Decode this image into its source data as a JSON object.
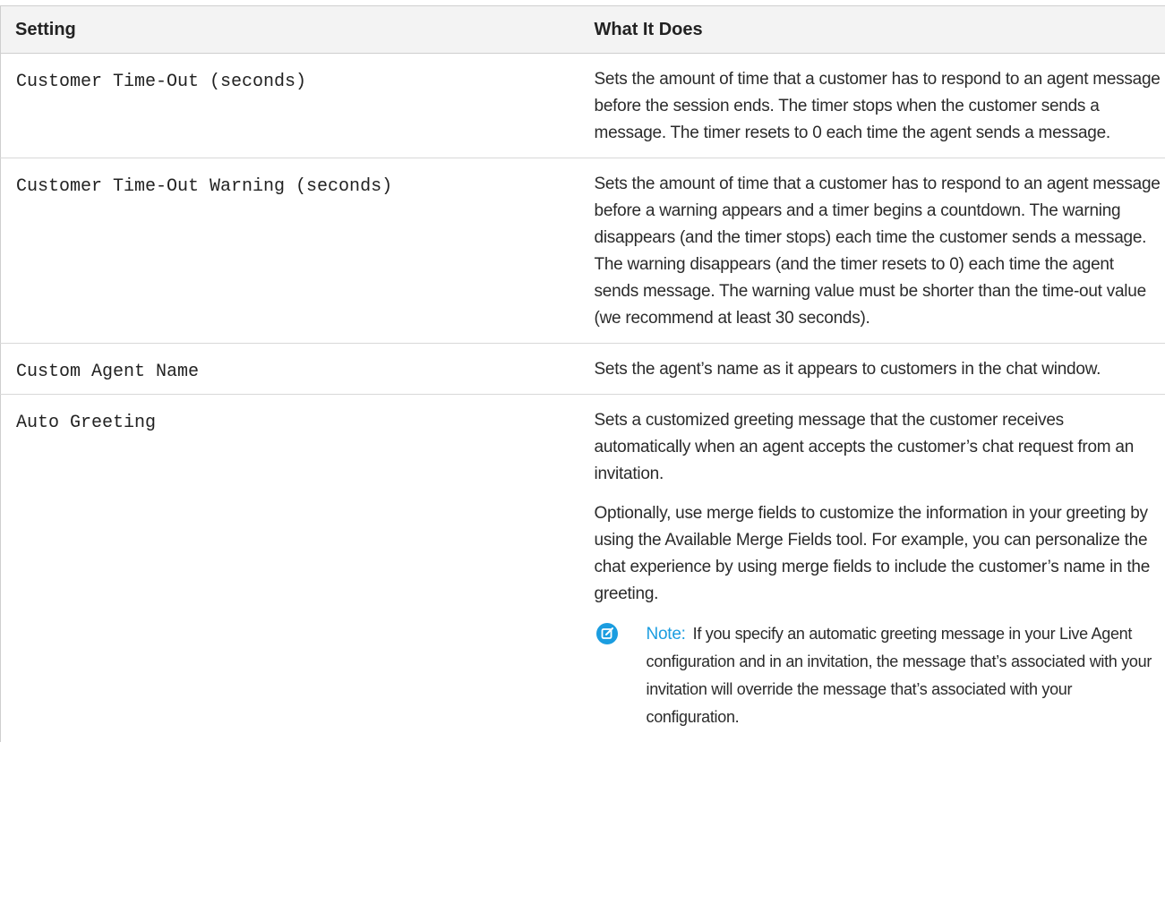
{
  "table": {
    "headers": [
      "Setting",
      "What It Does"
    ],
    "rows": [
      {
        "setting": "Customer Time-Out (seconds)",
        "paragraphs": [
          "Sets the amount of time that a customer has to respond to an agent message before the session ends. The timer stops when the customer sends a message. The timer resets to 0 each time the agent sends a message."
        ]
      },
      {
        "setting": "Customer Time-Out Warning (seconds)",
        "paragraphs": [
          "Sets the amount of time that a customer has to respond to an agent message before a warning appears and a timer begins a countdown. The warning disappears (and the timer stops) each time the customer sends a message. The warning disappears (and the timer resets to 0) each time the agent sends message. The warning value must be shorter than the time-out value (we recommend at least 30 seconds)."
        ]
      },
      {
        "setting": "Custom Agent Name",
        "paragraphs": [
          "Sets the agent’s name as it appears to customers in the chat window."
        ]
      },
      {
        "setting": "Auto Greeting",
        "paragraphs": [
          "Sets a customized greeting message that the customer receives automatically when an agent accepts the customer’s chat request from an invitation.",
          "Optionally, use merge fields to customize the information in your greeting by using the Available Merge Fields tool. For example, you can personalize the chat experience by using merge fields to include the customer’s name in the greeting."
        ],
        "note": {
          "icon": "note-edit-icon",
          "label": "Note:",
          "text": "If you specify an automatic greeting message in your Live Agent configuration and in an invitation, the message that’s associated with your invitation will override the message that’s associated with your configuration."
        }
      }
    ]
  },
  "colors": {
    "note_accent": "#1b9de0",
    "header_bg": "#f3f3f3"
  }
}
